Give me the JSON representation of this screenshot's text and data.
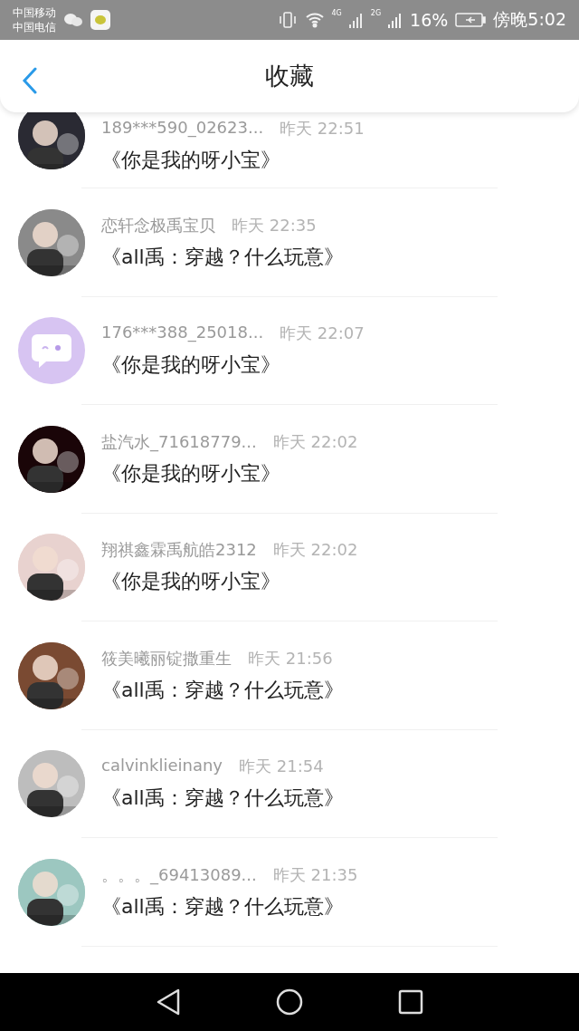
{
  "status_bar": {
    "carriers": [
      "中国移动",
      "中国电信"
    ],
    "battery": "16%",
    "time": "傍晚5:02",
    "network_labels": [
      "4G",
      "2G"
    ]
  },
  "header": {
    "title": "收藏"
  },
  "items": [
    {
      "name": "189***590_02623...",
      "time": "昨天 22:51",
      "title": "《你是我的呀小宝》"
    },
    {
      "name": "恋轩念极禹宝贝",
      "time": "昨天 22:35",
      "title": "《all禹：穿越？什么玩意》"
    },
    {
      "name": "176***388_25018...",
      "time": "昨天 22:07",
      "title": "《你是我的呀小宝》",
      "avatar": {
        "kind": "default",
        "color": "#d7c4f2"
      }
    },
    {
      "name": "盐汽水_71618779...",
      "time": "昨天 22:02",
      "title": "《你是我的呀小宝》"
    },
    {
      "name": "翔祺鑫霖禹航皓2312",
      "time": "昨天 22:02",
      "title": "《你是我的呀小宝》"
    },
    {
      "name": "筱美曦丽锭撒重生",
      "time": "昨天 21:56",
      "title": "《all禹：穿越？什么玩意》"
    },
    {
      "name": "calvinklieinany",
      "time": "昨天 21:54",
      "title": "《all禹：穿越？什么玩意》"
    },
    {
      "name": "。。。_69413089...",
      "time": "昨天 21:35",
      "title": "《all禹：穿越？什么玩意》"
    }
  ]
}
